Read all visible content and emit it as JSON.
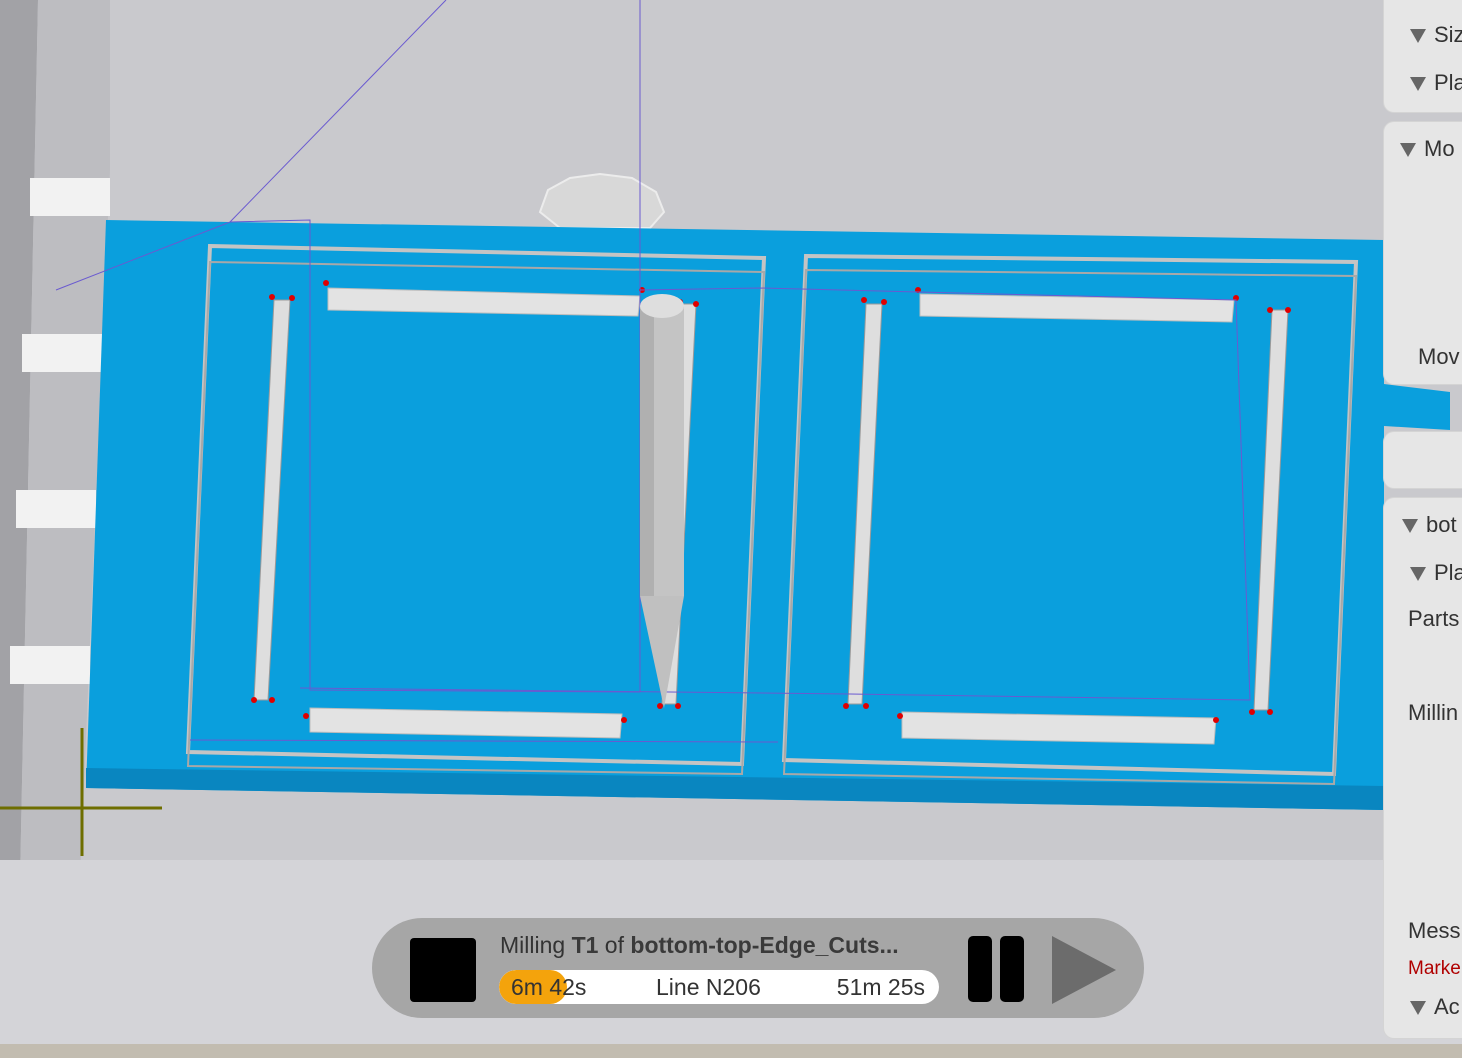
{
  "playback": {
    "prefix": "Milling ",
    "tool": "T1",
    "of": " of ",
    "file": "bottom-top-Edge_Cuts...",
    "elapsed": "6m 42s",
    "line": "Line N206",
    "remaining": "51m 25s",
    "progress_fraction": 0.155
  },
  "side_panel": {
    "size_label": "Siz",
    "placement_label": "Pla",
    "section_label": "Mo",
    "move_label": "Mov",
    "file_label": "bot",
    "placement2_label": "Pla",
    "parts_label": "Parts",
    "milling_label": "Millin",
    "messages_label": "Mess",
    "marker_label": "Marke",
    "actions_label": "Ac"
  },
  "colors": {
    "bed": "#0aa0e0",
    "background": "#c8c8cc",
    "progress": "#f4a30c",
    "toolpath": "#6a5ad0",
    "marker": "#e00000",
    "axis": "#6e6e00"
  },
  "icons": {
    "stop": "stop-square-icon",
    "pause": "pause-icon",
    "play": "play-triangle-icon",
    "collapse": "triangle-down-icon"
  }
}
